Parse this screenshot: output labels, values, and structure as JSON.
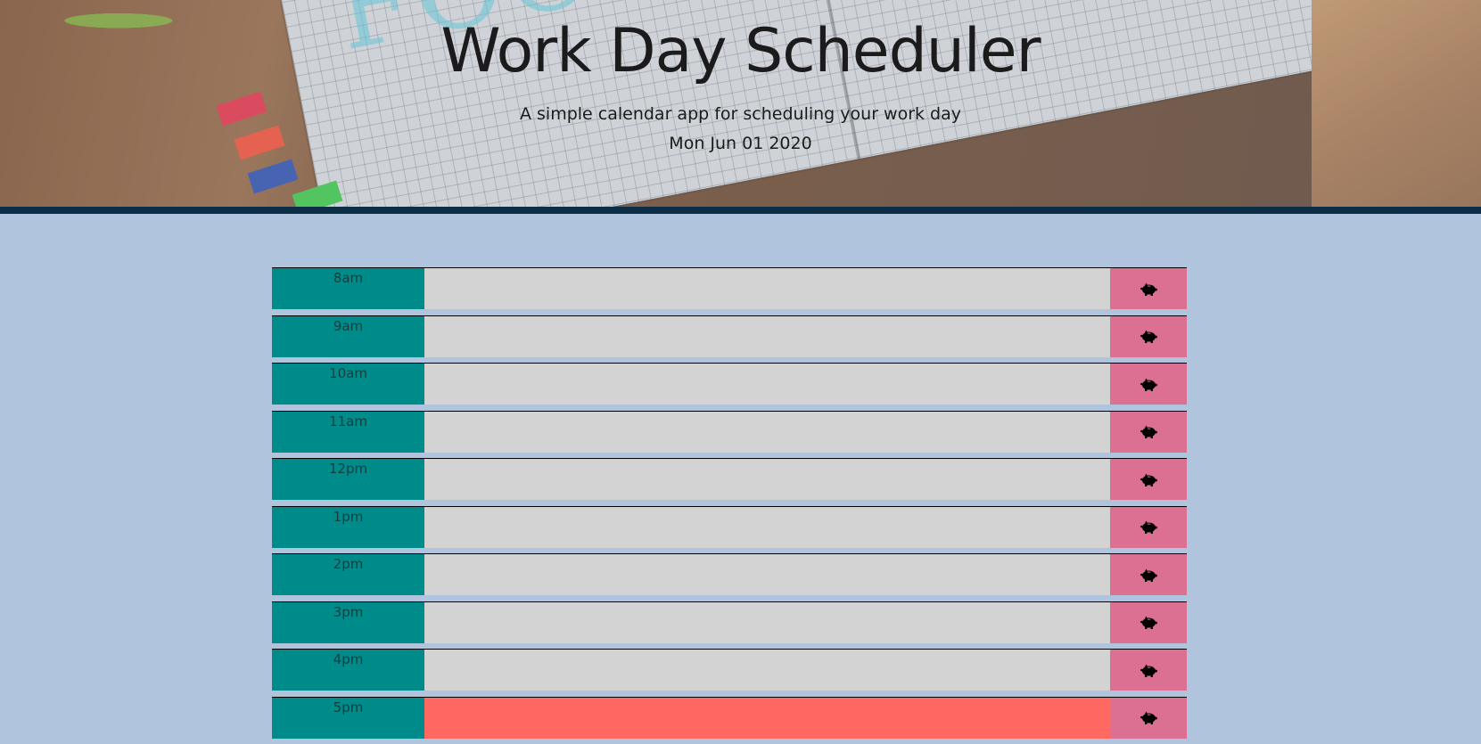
{
  "header": {
    "title": "Work Day Scheduler",
    "lead": "A simple calendar app for scheduling your work day",
    "current_day": "Mon Jun 01 2020"
  },
  "colors": {
    "background": "#b0c4de",
    "hour_block": "#008b8b",
    "future": "#d3d3d3",
    "present": "#ff6961",
    "save_button": "#db7093",
    "header_border": "#0b2d45"
  },
  "timeblocks": [
    {
      "hour": "8am",
      "status": "future",
      "text": "",
      "save_icon": "piggy-bank-icon"
    },
    {
      "hour": "9am",
      "status": "future",
      "text": "",
      "save_icon": "piggy-bank-icon"
    },
    {
      "hour": "10am",
      "status": "future",
      "text": "",
      "save_icon": "piggy-bank-icon"
    },
    {
      "hour": "11am",
      "status": "future",
      "text": "",
      "save_icon": "piggy-bank-icon"
    },
    {
      "hour": "12pm",
      "status": "future",
      "text": "",
      "save_icon": "piggy-bank-icon"
    },
    {
      "hour": "1pm",
      "status": "future",
      "text": "",
      "save_icon": "piggy-bank-icon"
    },
    {
      "hour": "2pm",
      "status": "future",
      "text": "",
      "save_icon": "piggy-bank-icon"
    },
    {
      "hour": "3pm",
      "status": "future",
      "text": "",
      "save_icon": "piggy-bank-icon"
    },
    {
      "hour": "4pm",
      "status": "future",
      "text": "",
      "save_icon": "piggy-bank-icon"
    },
    {
      "hour": "5pm",
      "status": "present",
      "text": "",
      "save_icon": "piggy-bank-icon"
    }
  ]
}
